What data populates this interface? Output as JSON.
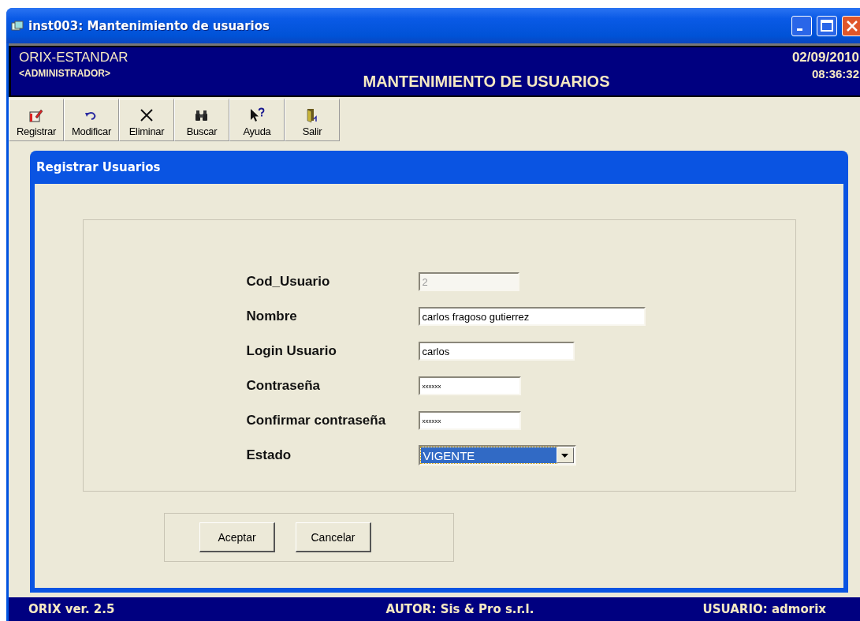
{
  "window": {
    "title": "inst003: Mantenimiento de usuarios"
  },
  "header": {
    "app_name": "ORIX-ESTANDAR",
    "role": "<ADMINISTRADOR>",
    "heading": "MANTENIMIENTO DE USUARIOS",
    "date": "02/09/2010",
    "time": "08:36:32"
  },
  "toolbar": [
    {
      "label": "Registrar"
    },
    {
      "label": "Modificar"
    },
    {
      "label": "Eliminar"
    },
    {
      "label": "Buscar"
    },
    {
      "label": "Ayuda"
    },
    {
      "label": "Salir"
    }
  ],
  "dialog": {
    "title": "Registrar Usuarios",
    "fields": [
      {
        "kind": "text",
        "label": "Cod_Usuario",
        "value": "2",
        "disabled": true
      },
      {
        "kind": "text",
        "label": "Nombre",
        "value": "carlos fragoso gutierrez",
        "disabled": false
      },
      {
        "kind": "text",
        "label": "Login Usuario",
        "value": "carlos",
        "disabled": false
      },
      {
        "kind": "password",
        "label": "Contraseña",
        "value": "xxxxxx",
        "disabled": false
      },
      {
        "kind": "password",
        "label": "Confirmar contraseña",
        "value": "xxxxxx",
        "disabled": false
      },
      {
        "kind": "combo",
        "label": "Estado",
        "value": "VIGENTE",
        "disabled": false
      }
    ],
    "buttons": [
      "Aceptar",
      "Cancelar"
    ]
  },
  "status_bar": {
    "version": "ORIX ver. 2.5",
    "author": "AUTOR: Sis & Pro s.r.l.",
    "user": "USUARIO: admorix"
  }
}
